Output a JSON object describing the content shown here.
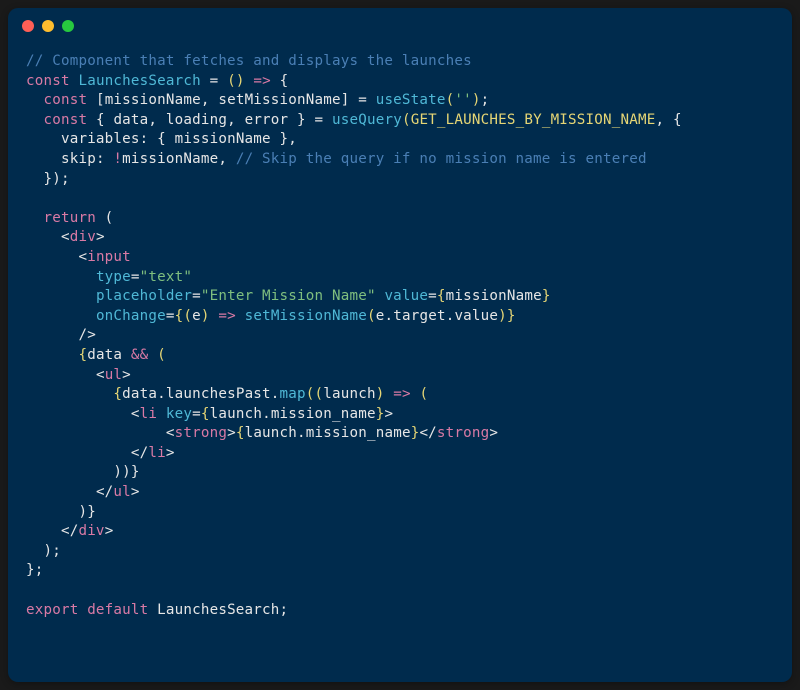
{
  "code": {
    "line1_comment": "// Component that fetches and displays the launches",
    "line2_const": "const",
    "line2_name": "LaunchesSearch",
    "line2_eq": " = ",
    "line2_paren1": "(",
    "line2_paren2": ")",
    "line2_arrow": " => ",
    "line2_brace": "{",
    "line3_const": "const",
    "line3_bracket1": " [",
    "line3_var1": "missionName",
    "line3_comma": ", ",
    "line3_var2": "setMissionName",
    "line3_bracket2": "] = ",
    "line3_func": "useState",
    "line3_paren1": "(",
    "line3_str": "''",
    "line3_paren2": ")",
    "line3_semi": ";",
    "line4_const": "const",
    "line4_brace1": " { ",
    "line4_var1": "data",
    "line4_c1": ", ",
    "line4_var2": "loading",
    "line4_c2": ", ",
    "line4_var3": "error",
    "line4_brace2": " } = ",
    "line4_func": "useQuery",
    "line4_paren1": "(",
    "line4_const_name": "GET_LAUNCHES_BY_MISSION_NAME",
    "line4_c3": ", {",
    "line5_key": "variables",
    "line5_colon": ": { ",
    "line5_val": "missionName",
    "line5_end": " },",
    "line6_key": "skip",
    "line6_colon": ": ",
    "line6_neg": "!",
    "line6_val": "missionName",
    "line6_c": ", ",
    "line6_comment": "// Skip the query if no mission name is entered",
    "line7": "  });",
    "line9_return": "return",
    "line9_paren": " (",
    "line10_open": "<",
    "line10_tag": "div",
    "line10_close": ">",
    "line11_open": "<",
    "line11_tag": "input",
    "line12_attr": "type",
    "line12_eq": "=",
    "line12_val": "\"text\"",
    "line13_attr1": "placeholder",
    "line13_eq1": "=",
    "line13_val1": "\"Enter Mission Name\"",
    "line13_attr2": " value",
    "line13_eq2": "=",
    "line13_brace1": "{",
    "line13_val2": "missionName",
    "line13_brace2": "}",
    "line14_attr": "onChange",
    "line14_eq": "=",
    "line14_brace1": "{",
    "line14_paren1": "(",
    "line14_param": "e",
    "line14_paren2": ")",
    "line14_arrow": " => ",
    "line14_func": "setMissionName",
    "line14_paren3": "(",
    "line14_e": "e",
    "line14_dot1": ".",
    "line14_target": "target",
    "line14_dot2": ".",
    "line14_value": "value",
    "line14_paren4": ")",
    "line14_brace2": "}",
    "line15": "/>",
    "line16_brace1": "{",
    "line16_var": "data",
    "line16_and": " && ",
    "line16_paren": "(",
    "line17_open": "<",
    "line17_tag": "ul",
    "line17_close": ">",
    "line18_brace1": "{",
    "line18_var": "data",
    "line18_dot": ".",
    "line18_prop": "launchesPast",
    "line18_dot2": ".",
    "line18_func": "map",
    "line18_paren1": "(",
    "line18_paren2": "(",
    "line18_param": "launch",
    "line18_paren3": ")",
    "line18_arrow": " => ",
    "line18_paren4": "(",
    "line19_open": "<",
    "line19_tag": "li",
    "line19_attr": " key",
    "line19_eq": "=",
    "line19_brace1": "{",
    "line19_var": "launch",
    "line19_dot": ".",
    "line19_prop": "mission_name",
    "line19_brace2": "}",
    "line19_close": ">",
    "line20_open": "<",
    "line20_tag": "strong",
    "line20_close1": ">",
    "line20_brace1": "{",
    "line20_var": "launch",
    "line20_dot": ".",
    "line20_prop": "mission_name",
    "line20_brace2": "}",
    "line20_open2": "</",
    "line20_tag2": "strong",
    "line20_close2": ">",
    "line21_open": "</",
    "line21_tag": "li",
    "line21_close": ">",
    "line22": "))}",
    "line23_open": "</",
    "line23_tag": "ul",
    "line23_close": ">",
    "line24": ")}",
    "line25_open": "</",
    "line25_tag": "div",
    "line25_close": ">",
    "line26": "  );",
    "line27": "};",
    "line29_export": "export",
    "line29_default": " default",
    "line29_name": " LaunchesSearch",
    "line29_semi": ";"
  }
}
